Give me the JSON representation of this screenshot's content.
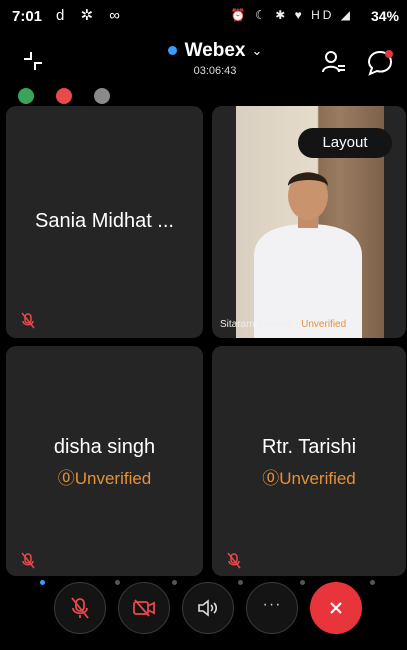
{
  "status_bar": {
    "time": "7:01",
    "left_icons": "d ✲ ∞",
    "right_icons": "⏰ ☾ ✱ ♥ HD ◢",
    "battery": "34%"
  },
  "header": {
    "app_title": "Webex",
    "duration": "03:06:43"
  },
  "participants": [
    {
      "name": "Sania Midhat ...",
      "status": "",
      "muted": true
    },
    {
      "name": "Sitaram Sharma",
      "status": "Unverified",
      "muted": false,
      "video_on": true
    },
    {
      "name": "disha singh",
      "status": "⓪Unverified",
      "muted": true
    },
    {
      "name": "Rtr. Tarishi",
      "status": "⓪Unverified",
      "muted": true
    }
  ],
  "video_tile": {
    "layout_label": "Layout",
    "label_name": "Sitaram Sharma",
    "label_sep": " - ",
    "label_status": "Unverified"
  },
  "controls": {
    "mute_icon": "mic-muted-icon",
    "video_icon": "video-off-icon",
    "audio_icon": "speaker-icon",
    "more_label": "···",
    "end_icon": "close-icon"
  },
  "colors": {
    "accent_blue": "#3b9cff",
    "unverified_orange": "#e3913b",
    "end_call_red": "#e8343b",
    "tile_bg": "#252525",
    "reaction_green": "#3aa45b",
    "reaction_red": "#e84a4a",
    "reaction_gray": "#8a8a8a"
  }
}
